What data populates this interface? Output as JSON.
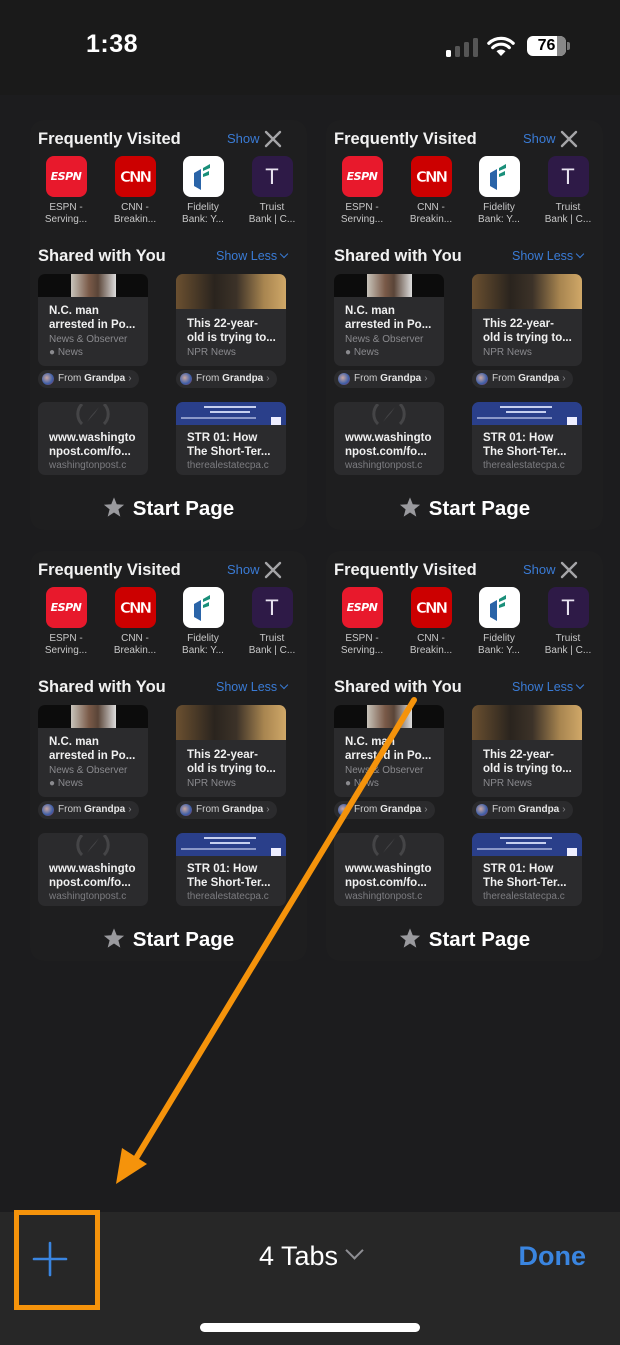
{
  "status_bar": {
    "time": "1:38",
    "signal_bars_active": 1,
    "signal_bars_total": 4,
    "wifi_icon": "wifi-icon",
    "battery_percent": "76",
    "battery_level": 0.76
  },
  "tabs": [
    {
      "frequently_visited": {
        "title": "Frequently Visited",
        "show_label": "Show",
        "close_icon": "close-icon",
        "items": [
          {
            "line1": "ESPN -",
            "line2": "Serving...",
            "logo": "ESPN",
            "color": "#e8192c"
          },
          {
            "line1": "CNN -",
            "line2": "Breakin...",
            "logo": "CNN",
            "color": "#cc0000"
          },
          {
            "line1": "Fidelity",
            "line2": "Bank: Y...",
            "logo": "fidelity-logo",
            "color": "#ffffff"
          },
          {
            "line1": "Truist",
            "line2": "Bank | C...",
            "logo": "T",
            "color": "#2e1a47"
          }
        ]
      },
      "shared_with_you": {
        "title": "Shared with You",
        "show_less_label": "Show Less",
        "articles": [
          {
            "title_line1": "N.C. man",
            "title_line2": "arrested in Po...",
            "source_line1": "News & Observer",
            "source_line2": " News",
            "from_prefix": "From",
            "from_name": "Grandpa"
          },
          {
            "title_line1": "This 22-year-",
            "title_line2": "old is trying to...",
            "source_line1": "NPR  News",
            "from_prefix": "From",
            "from_name": "Grandpa"
          }
        ],
        "links": [
          {
            "title_line1": "www.washingto",
            "title_line2": "npost.com/fo...",
            "source": "washingtonpost.c"
          },
          {
            "title_line1": "STR 01: How",
            "title_line2": "The Short-Ter...",
            "source": "therealestatecpa.c"
          }
        ]
      },
      "tab_title": "Start Page"
    },
    {
      "frequently_visited": {
        "title": "Frequently Visited",
        "show_label": "Show",
        "close_icon": "close-icon",
        "items": [
          {
            "line1": "ESPN -",
            "line2": "Serving...",
            "logo": "ESPN",
            "color": "#e8192c"
          },
          {
            "line1": "CNN -",
            "line2": "Breakin...",
            "logo": "CNN",
            "color": "#cc0000"
          },
          {
            "line1": "Fidelity",
            "line2": "Bank: Y...",
            "logo": "fidelity-logo",
            "color": "#ffffff"
          },
          {
            "line1": "Truist",
            "line2": "Bank | C...",
            "logo": "T",
            "color": "#2e1a47"
          }
        ]
      },
      "shared_with_you": {
        "title": "Shared with You",
        "show_less_label": "Show Less",
        "articles": [
          {
            "title_line1": "N.C. man",
            "title_line2": "arrested in Po...",
            "source_line1": "News & Observer",
            "source_line2": " News",
            "from_prefix": "From",
            "from_name": "Grandpa"
          },
          {
            "title_line1": "This 22-year-",
            "title_line2": "old is trying to...",
            "source_line1": "NPR  News",
            "from_prefix": "From",
            "from_name": "Grandpa"
          }
        ],
        "links": [
          {
            "title_line1": "www.washingto",
            "title_line2": "npost.com/fo...",
            "source": "washingtonpost.c"
          },
          {
            "title_line1": "STR 01: How",
            "title_line2": "The Short-Ter...",
            "source": "therealestatecpa.c"
          }
        ]
      },
      "tab_title": "Start Page"
    },
    {
      "frequently_visited": {
        "title": "Frequently Visited",
        "show_label": "Show",
        "close_icon": "close-icon",
        "items": [
          {
            "line1": "ESPN -",
            "line2": "Serving...",
            "logo": "ESPN",
            "color": "#e8192c"
          },
          {
            "line1": "CNN -",
            "line2": "Breakin...",
            "logo": "CNN",
            "color": "#cc0000"
          },
          {
            "line1": "Fidelity",
            "line2": "Bank: Y...",
            "logo": "fidelity-logo",
            "color": "#ffffff"
          },
          {
            "line1": "Truist",
            "line2": "Bank | C...",
            "logo": "T",
            "color": "#2e1a47"
          }
        ]
      },
      "shared_with_you": {
        "title": "Shared with You",
        "show_less_label": "Show Less",
        "articles": [
          {
            "title_line1": "N.C. man",
            "title_line2": "arrested in Po...",
            "source_line1": "News & Observer",
            "source_line2": " News",
            "from_prefix": "From",
            "from_name": "Grandpa"
          },
          {
            "title_line1": "This 22-year-",
            "title_line2": "old is trying to...",
            "source_line1": "NPR  News",
            "from_prefix": "From",
            "from_name": "Grandpa"
          }
        ],
        "links": [
          {
            "title_line1": "www.washingto",
            "title_line2": "npost.com/fo...",
            "source": "washingtonpost.c"
          },
          {
            "title_line1": "STR 01: How",
            "title_line2": "The Short-Ter...",
            "source": "therealestatecpa.c"
          }
        ]
      },
      "tab_title": "Start Page"
    },
    {
      "frequently_visited": {
        "title": "Frequently Visited",
        "show_label": "Show",
        "close_icon": "close-icon",
        "items": [
          {
            "line1": "ESPN -",
            "line2": "Serving...",
            "logo": "ESPN",
            "color": "#e8192c"
          },
          {
            "line1": "CNN -",
            "line2": "Breakin...",
            "logo": "CNN",
            "color": "#cc0000"
          },
          {
            "line1": "Fidelity",
            "line2": "Bank: Y...",
            "logo": "fidelity-logo",
            "color": "#ffffff"
          },
          {
            "line1": "Truist",
            "line2": "Bank | C...",
            "logo": "T",
            "color": "#2e1a47"
          }
        ]
      },
      "shared_with_you": {
        "title": "Shared with You",
        "show_less_label": "Show Less",
        "articles": [
          {
            "title_line1": "N.C. man",
            "title_line2": "arrested in Po...",
            "source_line1": "News & Observer",
            "source_line2": " News",
            "from_prefix": "From",
            "from_name": "Grandpa"
          },
          {
            "title_line1": "This 22-year-",
            "title_line2": "old is trying to...",
            "source_line1": "NPR  News",
            "from_prefix": "From",
            "from_name": "Grandpa"
          }
        ],
        "links": [
          {
            "title_line1": "www.washingto",
            "title_line2": "npost.com/fo...",
            "source": "washingtonpost.c"
          },
          {
            "title_line1": "STR 01: How",
            "title_line2": "The Short-Ter...",
            "source": "therealestatecpa.c"
          }
        ]
      },
      "tab_title": "Start Page"
    }
  ],
  "toolbar": {
    "new_tab_icon": "plus-icon",
    "tabs_count_label": "4 Tabs",
    "done_label": "Done",
    "accent_color": "#3a85e0"
  },
  "annotation": {
    "color": "#f5930b",
    "highlights": "new-tab-button"
  }
}
